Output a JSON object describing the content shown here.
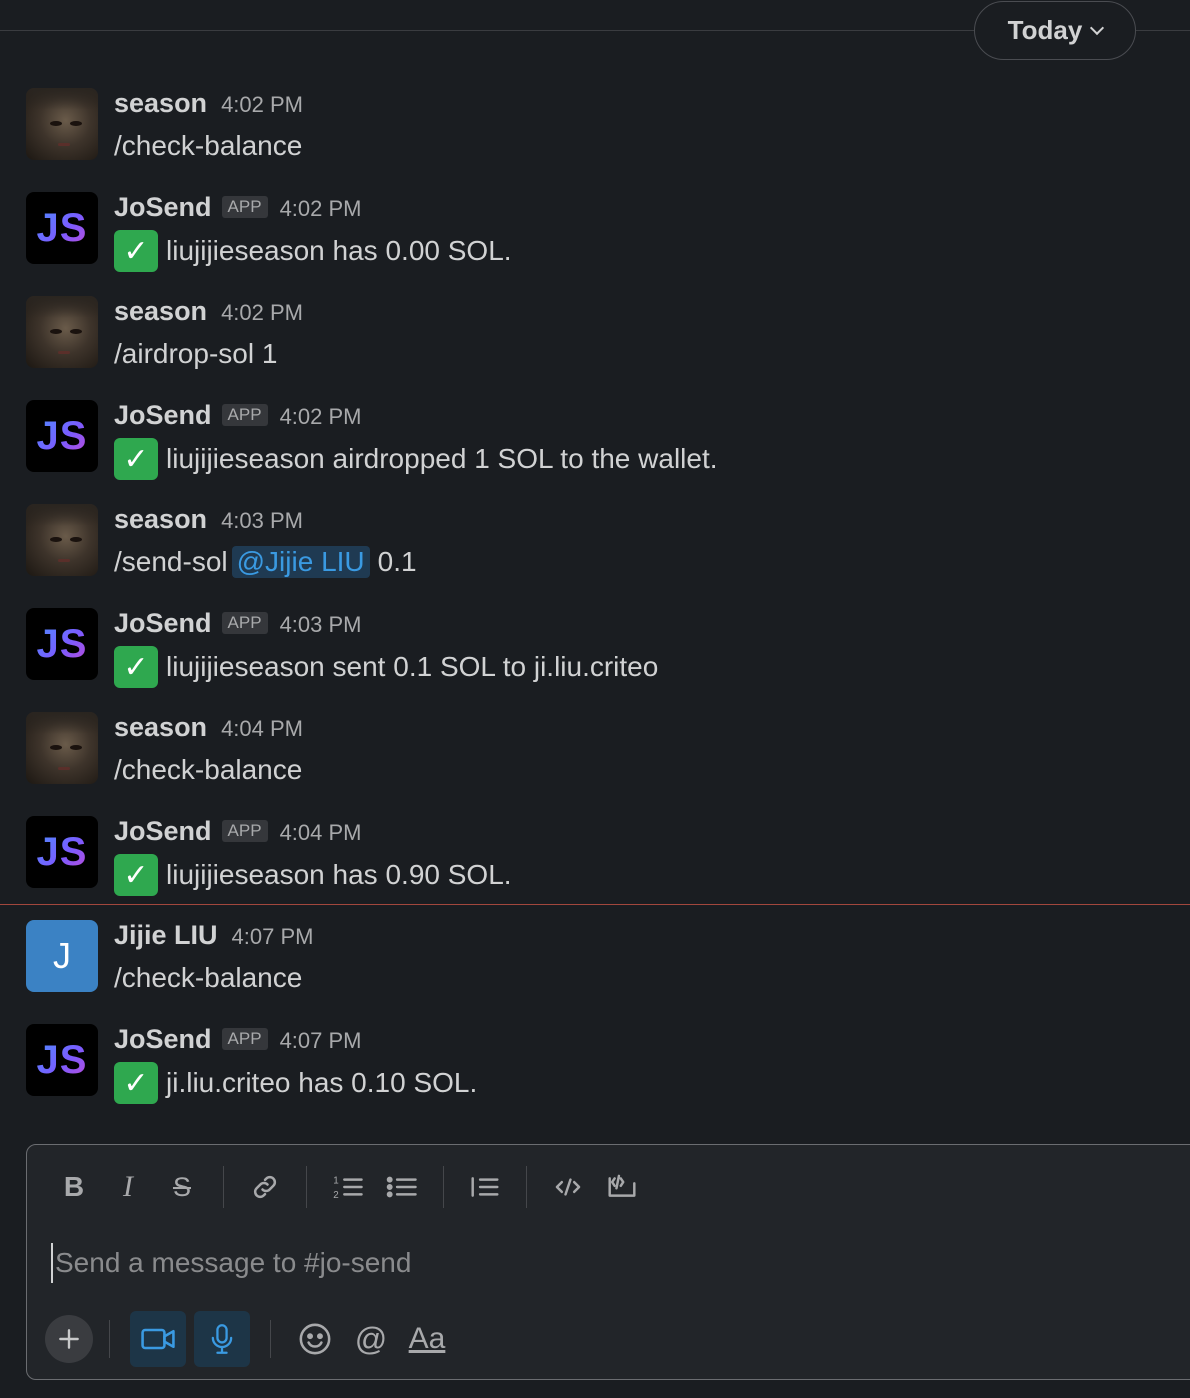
{
  "date_divider": {
    "label": "Today"
  },
  "messages": [
    {
      "sender": "season",
      "avatar": "photo",
      "is_app": false,
      "time": "4:02 PM",
      "text": "/check-balance"
    },
    {
      "sender": "JoSend",
      "avatar": "JS",
      "is_app": true,
      "app_badge": "APP",
      "time": "4:02 PM",
      "check": true,
      "text": "liujijieseason has 0.00 SOL."
    },
    {
      "sender": "season",
      "avatar": "photo",
      "is_app": false,
      "time": "4:02 PM",
      "text": "/airdrop-sol 1"
    },
    {
      "sender": "JoSend",
      "avatar": "JS",
      "is_app": true,
      "app_badge": "APP",
      "time": "4:02 PM",
      "check": true,
      "text": "liujijieseason airdropped 1 SOL to the wallet."
    },
    {
      "sender": "season",
      "avatar": "photo",
      "is_app": false,
      "time": "4:03 PM",
      "text_before": "/send-sol",
      "mention": "@Jijie LIU",
      "text_after": "0.1"
    },
    {
      "sender": "JoSend",
      "avatar": "JS",
      "is_app": true,
      "app_badge": "APP",
      "time": "4:03 PM",
      "check": true,
      "text": "liujijieseason sent 0.1 SOL to ji.liu.criteo"
    },
    {
      "sender": "season",
      "avatar": "photo",
      "is_app": false,
      "time": "4:04 PM",
      "text": "/check-balance"
    },
    {
      "sender": "JoSend",
      "avatar": "JS",
      "is_app": true,
      "app_badge": "APP",
      "time": "4:04 PM",
      "check": true,
      "text": "liujijieseason has 0.90 SOL."
    },
    {
      "sender": "Jijie LIU",
      "avatar": "J",
      "is_app": false,
      "time": "4:07 PM",
      "text": "/check-balance"
    },
    {
      "sender": "JoSend",
      "avatar": "JS",
      "is_app": true,
      "app_badge": "APP",
      "time": "4:07 PM",
      "check": true,
      "text": "ji.liu.criteo has 0.10 SOL."
    }
  ],
  "composer": {
    "placeholder": "Send a message to #jo-send",
    "toolbar": [
      "bold",
      "italic",
      "strikethrough",
      "link",
      "ordered-list",
      "bulleted-list",
      "blockquote",
      "code",
      "code-block"
    ],
    "bottom_actions": [
      "plus",
      "video",
      "microphone",
      "emoji",
      "mention",
      "formatting"
    ],
    "format_label": "Aa",
    "mention_symbol": "@"
  },
  "colors": {
    "background": "#1a1d21",
    "mention_text": "#3a9ae2",
    "new_messages_line": "#a2473d",
    "check_green": "#2fa84f",
    "jijie_avatar": "#3b82c4"
  }
}
